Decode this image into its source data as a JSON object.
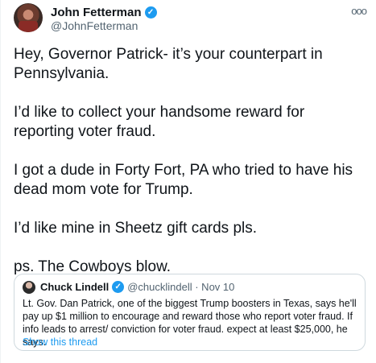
{
  "tweet": {
    "author_name": "John Fetterman",
    "author_handle": "@JohnFetterman",
    "more_icon": "more-icon",
    "paragraphs": [
      "Hey, Governor Patrick- it’s your counterpart in Pennsylvania.",
      "I’d like to collect your handsome reward for reporting voter fraud.",
      "I got a dude in Forty Fort, PA who tried to have his dead mom vote for Trump.",
      "I’d like mine in Sheetz gift cards pls.",
      "ps.  The Cowboys blow."
    ]
  },
  "quoted": {
    "author_name": "Chuck Lindell",
    "meta": "@chucklindell · Nov 10",
    "text": "Lt. Gov. Dan Patrick, one of the biggest Trump boosters in Texas, says he'll pay up $1 million to encourage and reward those who report voter fraud. If info leads to arrest/ conviction for voter fraud. expect at least $25,000, he says.",
    "show_thread": "Show this thread"
  },
  "colors": {
    "accent": "#1d9bf0",
    "text": "#0f1419",
    "muted": "#536471",
    "border": "#cfd9de"
  }
}
